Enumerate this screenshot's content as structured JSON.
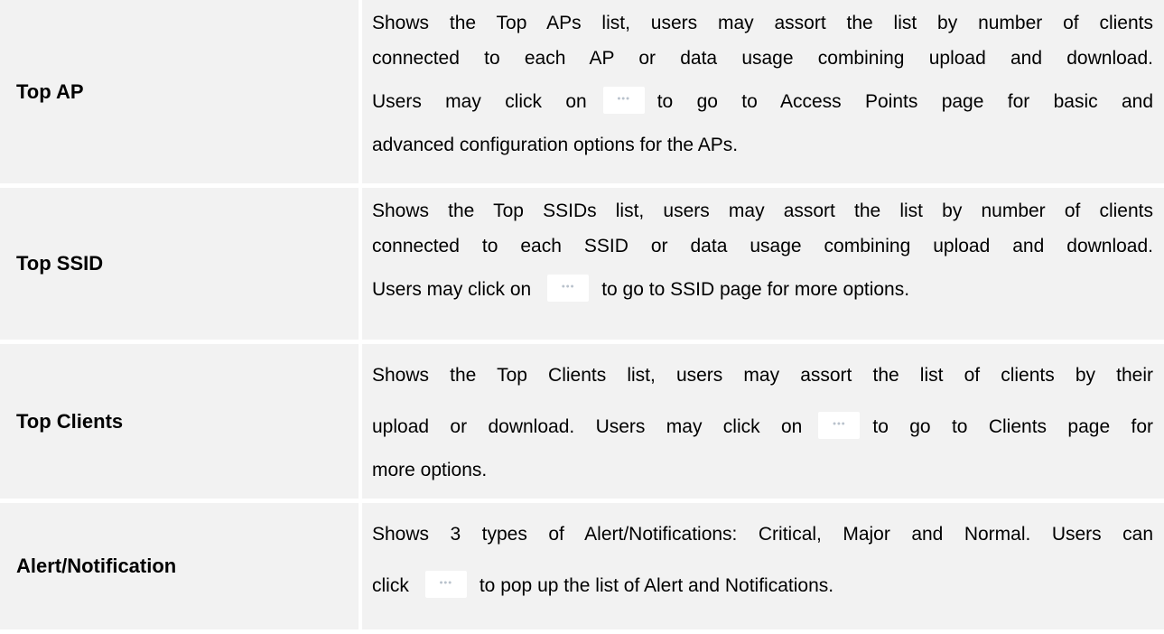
{
  "rows": [
    {
      "label": "Top AP",
      "lines": [
        "Shows the Top APs list, users may assort the list by number of clients",
        "connected to each AP or data usage combining upload and download.",
        [
          "Users may click on",
          "to go to Access Points page for basic and"
        ],
        "advanced configuration options for the APs."
      ]
    },
    {
      "label": "Top SSID",
      "lines": [
        "Shows the Top SSIDs list, users may assort the list by number of clients",
        "connected to each SSID or data usage combining upload and download.",
        [
          "Users may click on",
          "to go to SSID page for more options."
        ]
      ]
    },
    {
      "label": "Top Clients",
      "lines": [
        "Shows the Top Clients list, users may assort the list of clients by their",
        [
          "upload or download. Users may click on",
          "to go to Clients page for"
        ],
        "more options."
      ]
    },
    {
      "label": "Alert/Notification",
      "lines": [
        "Shows 3 types of Alert/Notifications: Critical, Major and Normal. Users can",
        [
          "click",
          "to pop up the list of Alert and Notifications."
        ]
      ]
    }
  ],
  "more_button_icon": "more-dots-icon",
  "more_button_glyph": "•••"
}
